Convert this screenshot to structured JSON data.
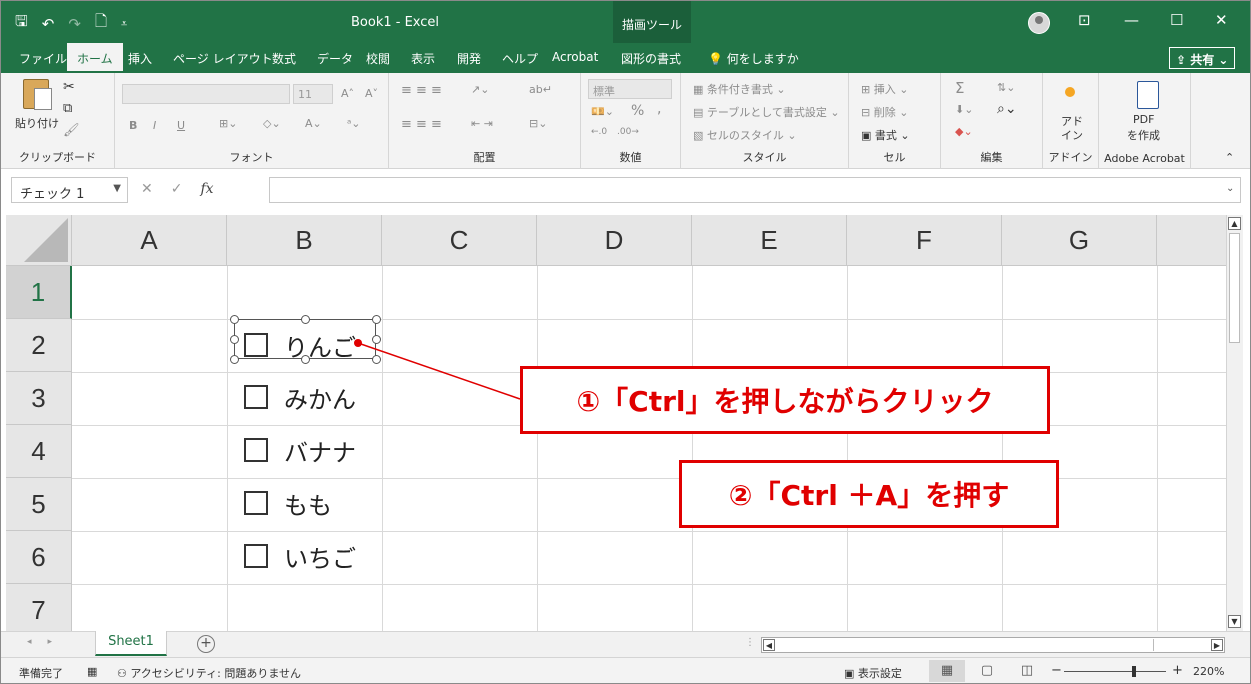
{
  "titlebar": {
    "title": "Book1  -  Excel",
    "contextual_tab": "描画ツール",
    "save_glyph": "🖫",
    "undo_glyph": "↶",
    "redo_glyph": "↷",
    "preview_glyph": "🗋",
    "customize_glyph": "⩡",
    "ribbon_options_glyph": "⊡",
    "minimize_glyph": "—",
    "maximize_glyph": "☐",
    "close_glyph": "✕"
  },
  "menu": {
    "tabs": [
      "ファイル",
      "ホーム",
      "挿入",
      "ページ レイアウト",
      "数式",
      "データ",
      "校閲",
      "表示",
      "開発",
      "ヘルプ",
      "Acrobat",
      "図形の書式"
    ],
    "tell_me": "何をしますか",
    "share": "共有"
  },
  "ribbon": {
    "clipboard": {
      "label": "クリップボード",
      "paste": "貼り付け"
    },
    "font": {
      "label": "フォント",
      "size": "11",
      "bold": "B",
      "italic": "I",
      "underline": "U"
    },
    "alignment": {
      "label": "配置"
    },
    "number": {
      "label": "数値",
      "format": "標準",
      "percent": "%",
      "comma": ","
    },
    "styles": {
      "label": "スタイル",
      "conditional": "条件付き書式",
      "table": "テーブルとして書式設定",
      "cell_styles": "セルのスタイル"
    },
    "cells": {
      "label": "セル",
      "insert": "挿入",
      "delete": "削除",
      "format": "書式"
    },
    "editing": {
      "label": "編集",
      "sum": "Σ"
    },
    "addins": {
      "label": "アドイン",
      "button_line1": "アド",
      "button_line2": "イン"
    },
    "acrobat": {
      "label": "Adobe Acrobat",
      "pdf_line1": "PDF",
      "pdf_line2": "を作成"
    },
    "collapse_glyph": "⌃"
  },
  "formula_bar": {
    "name_box": "チェック 1",
    "cancel_glyph": "✕",
    "enter_glyph": "✓",
    "fx": "fx",
    "value": ""
  },
  "grid": {
    "columns": [
      "A",
      "B",
      "C",
      "D",
      "E",
      "F",
      "G"
    ],
    "rows": [
      "1",
      "2",
      "3",
      "4",
      "5",
      "6",
      "7"
    ],
    "checkboxes": [
      "りんご",
      "みかん",
      "バナナ",
      "もも",
      "いちご"
    ]
  },
  "annotations": {
    "step1": "①「Ctrl」を押しながらクリック",
    "step2": "②「Ctrl ＋A」を押す",
    "color": "#e00000"
  },
  "sheets": {
    "tabs": [
      "Sheet1"
    ],
    "add": "+"
  },
  "status": {
    "ready": "準備完了",
    "accessibility": "アクセシビリティ: 問題ありません",
    "display_settings": "表示設定",
    "zoom": "220%",
    "zoom_minus": "−",
    "zoom_plus": "+"
  },
  "colors": {
    "brand": "#217346",
    "accent_red": "#e00000"
  }
}
